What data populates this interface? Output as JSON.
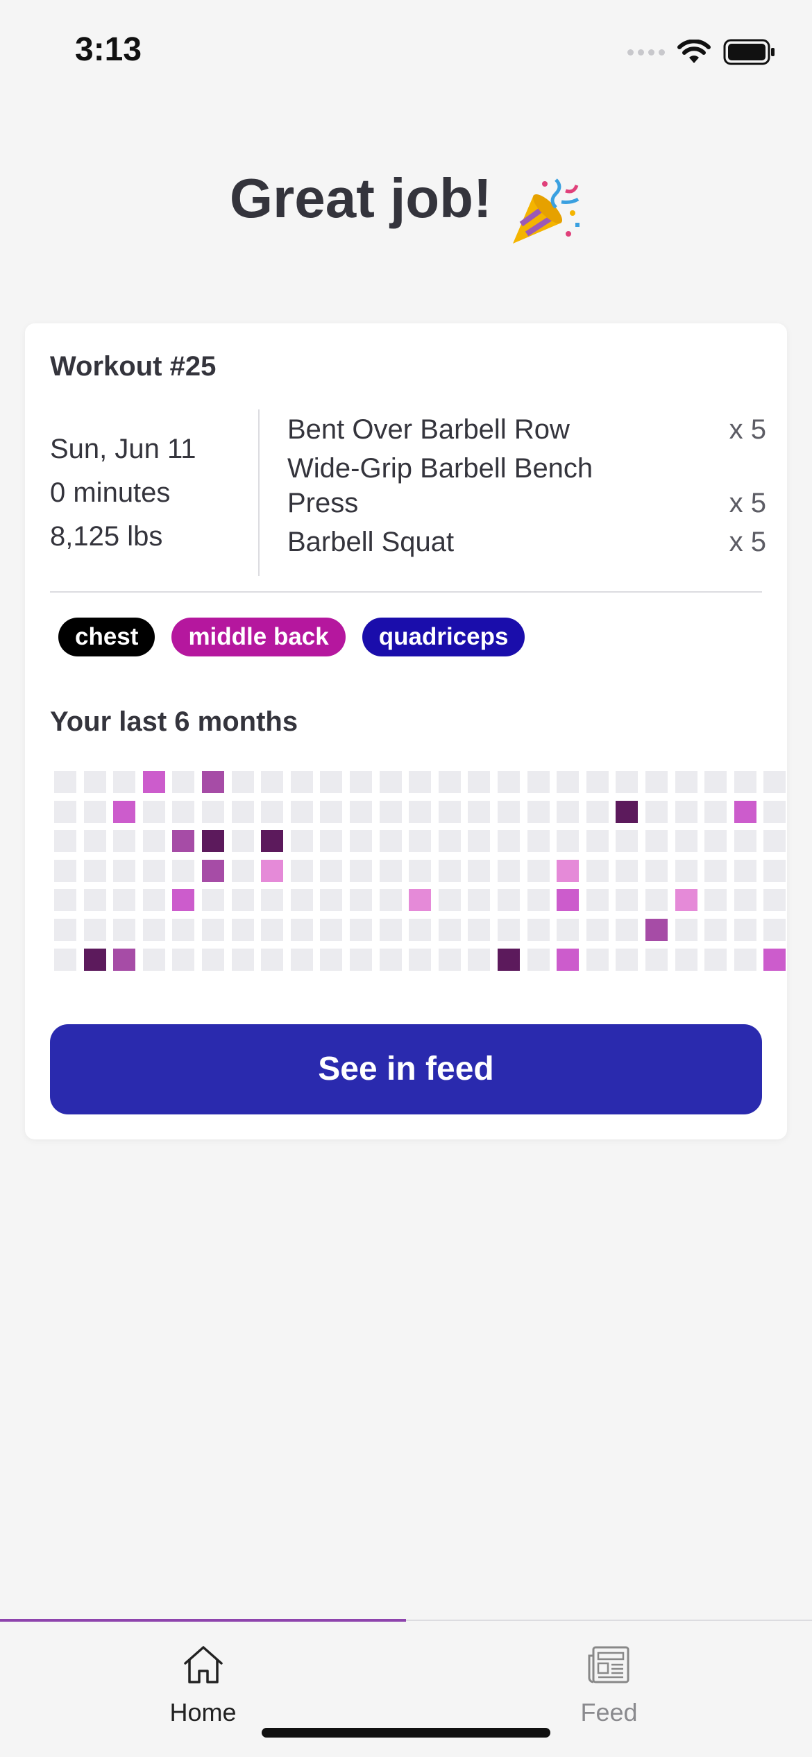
{
  "status_bar": {
    "time": "3:13"
  },
  "page_title": "Great job!",
  "workout": {
    "title": "Workout #25",
    "date": "Sun, Jun 11",
    "duration": "0 minutes",
    "volume": "8,125 lbs",
    "exercises": [
      {
        "name": "Bent Over Barbell Row",
        "sets": "x 5"
      },
      {
        "name": "Wide-Grip Barbell Bench Press",
        "sets": "x 5"
      },
      {
        "name": "Barbell Squat",
        "sets": "x 5"
      }
    ],
    "tags": [
      {
        "label": "chest",
        "color": "#000000"
      },
      {
        "label": "middle back",
        "color": "#b5179e"
      },
      {
        "label": "quadriceps",
        "color": "#1a0dab"
      }
    ]
  },
  "history": {
    "title": "Your last 6 months",
    "colors": {
      "0": "#ebebef",
      "1": "#e58ad8",
      "2": "#cc5ccc",
      "3": "#a64ca6",
      "4": "#5c1a5c"
    },
    "grid": [
      [
        0,
        0,
        0,
        2,
        0,
        3,
        0,
        0,
        0,
        0,
        0,
        0,
        0,
        0,
        0,
        0,
        0,
        0,
        0,
        0,
        0,
        0,
        0,
        0,
        0
      ],
      [
        0,
        0,
        2,
        0,
        0,
        0,
        0,
        0,
        0,
        0,
        0,
        0,
        0,
        0,
        0,
        0,
        0,
        0,
        0,
        4,
        0,
        0,
        0,
        2,
        0
      ],
      [
        0,
        0,
        0,
        0,
        3,
        4,
        0,
        4,
        0,
        0,
        0,
        0,
        0,
        0,
        0,
        0,
        0,
        0,
        0,
        0,
        0,
        0,
        0,
        0,
        0
      ],
      [
        0,
        0,
        0,
        0,
        0,
        3,
        0,
        1,
        0,
        0,
        0,
        0,
        0,
        0,
        0,
        0,
        0,
        1,
        0,
        0,
        0,
        0,
        0,
        0,
        0
      ],
      [
        0,
        0,
        0,
        0,
        2,
        0,
        0,
        0,
        0,
        0,
        0,
        0,
        1,
        0,
        0,
        0,
        0,
        2,
        0,
        0,
        0,
        1,
        0,
        0,
        0
      ],
      [
        0,
        0,
        0,
        0,
        0,
        0,
        0,
        0,
        0,
        0,
        0,
        0,
        0,
        0,
        0,
        0,
        0,
        0,
        0,
        0,
        3,
        0,
        0,
        0,
        0
      ],
      [
        0,
        4,
        3,
        0,
        0,
        0,
        0,
        0,
        0,
        0,
        0,
        0,
        0,
        0,
        0,
        4,
        0,
        2,
        0,
        0,
        0,
        0,
        0,
        0,
        2
      ]
    ]
  },
  "cta_label": "See in feed",
  "tabbar": {
    "tabs": [
      {
        "label": "Home",
        "icon": "home-icon",
        "active": true
      },
      {
        "label": "Feed",
        "icon": "newspaper-icon",
        "active": false
      }
    ]
  }
}
